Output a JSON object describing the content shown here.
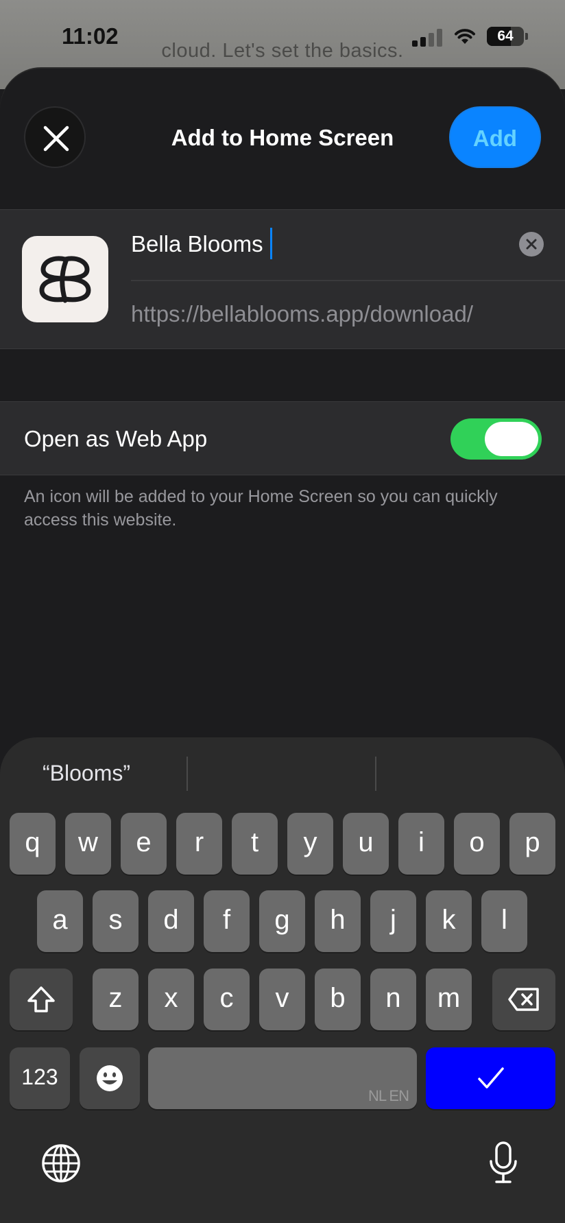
{
  "status_bar": {
    "time": "11:02",
    "battery_level": "64",
    "battery_percent": 64
  },
  "background_page": {
    "visible_text": "cloud. Let's set the basics."
  },
  "sheet": {
    "title": "Add to Home Screen",
    "close_icon": "close-icon",
    "add_label": "Add",
    "add_color": "#0a84ff"
  },
  "app_info": {
    "icon": "bella-blooms-logo",
    "name_value": "Bella Blooms",
    "url": "https://bellablooms.app/download/"
  },
  "web_app": {
    "label": "Open as Web App",
    "enabled": true,
    "toggle_color": "#30d158",
    "footnote": "An icon will be added to your Home Screen so you can quickly access this website."
  },
  "keyboard": {
    "suggestions": [
      "“Blooms”",
      "",
      ""
    ],
    "row1": [
      "q",
      "w",
      "e",
      "r",
      "t",
      "y",
      "u",
      "i",
      "o",
      "p"
    ],
    "row2": [
      "a",
      "s",
      "d",
      "f",
      "g",
      "h",
      "j",
      "k",
      "l"
    ],
    "row3": [
      "z",
      "x",
      "c",
      "v",
      "b",
      "n",
      "m"
    ],
    "numbers_label": "123",
    "space_lang": "NL EN",
    "done_color": "#0000ff",
    "icons": [
      "shift-icon",
      "delete-icon",
      "emoji-icon",
      "checkmark-icon",
      "globe-icon",
      "microphone-icon"
    ]
  }
}
